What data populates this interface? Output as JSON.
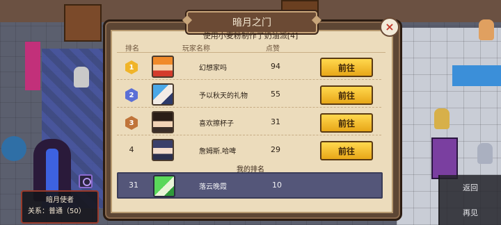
{
  "modal": {
    "title": "暗月之门",
    "subtitle": "使用小麦粉制作了奶油派[4]",
    "close_label": "×",
    "headers": {
      "rank": "排名",
      "player": "玩家名称",
      "likes": "点赞"
    },
    "rows": [
      {
        "rank": "1",
        "name": "幻想家吗",
        "likes": "94",
        "action": "前往",
        "badge": "gold"
      },
      {
        "rank": "2",
        "name": "予以秋天的礼物",
        "likes": "55",
        "action": "前往",
        "badge": "blue"
      },
      {
        "rank": "3",
        "name": "喜欢擦杯子",
        "likes": "31",
        "action": "前往",
        "badge": "bronze"
      },
      {
        "rank": "4",
        "name": "詹姆斯.哈啤",
        "likes": "29",
        "action": "前往",
        "badge": "none"
      }
    ],
    "my_rank_label": "我的排名",
    "my_row": {
      "rank": "31",
      "name": "落云晚霞",
      "likes": "10"
    }
  },
  "npc_tag": {
    "name": "暗月使者",
    "relation_label": "关系：",
    "relation_value": "普通（50）"
  },
  "side_buttons": {
    "back": "返回",
    "bye": "再见"
  },
  "colors": {
    "gold": "#f0b429",
    "blue": "#5b6fd6",
    "bronze": "#c0743a",
    "button": "#f5c234"
  }
}
